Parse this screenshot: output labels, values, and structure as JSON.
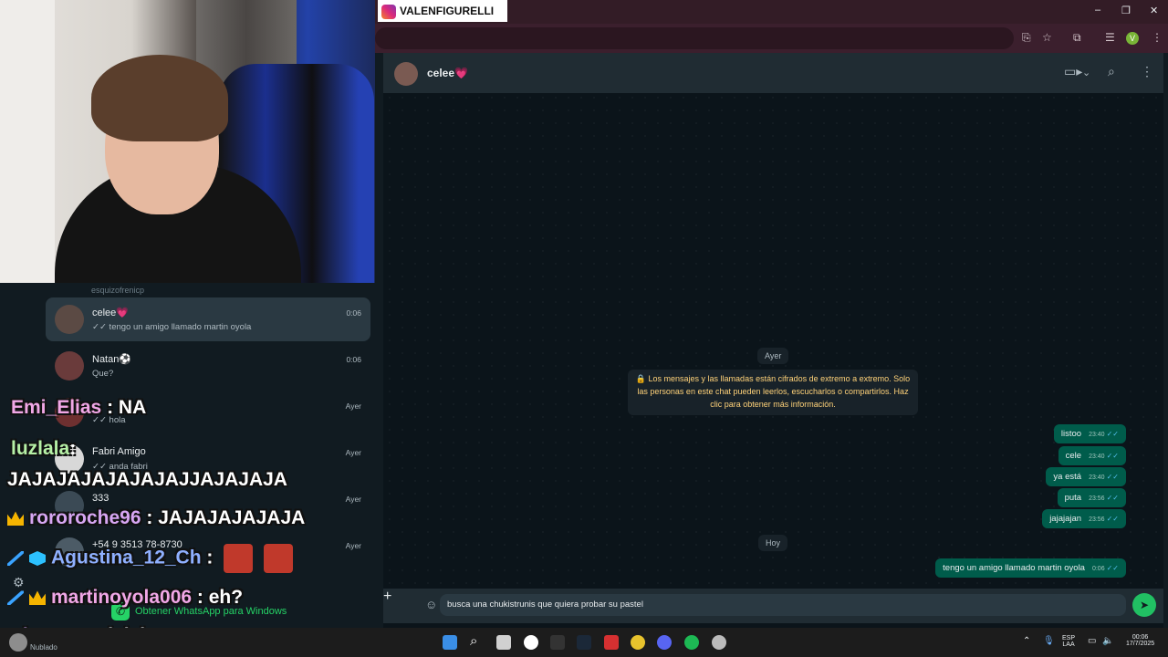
{
  "stream_badge": {
    "name": "VALENFIGURELLI"
  },
  "window_controls": {
    "minimize": "–",
    "restore": "❐",
    "close": "✕"
  },
  "browser": {
    "profile_initial": "V"
  },
  "chat_list": {
    "top_partial": "esquizofrenicp",
    "items": [
      {
        "name": "celee💗",
        "last_message": "✓✓ tengo un amigo llamado martin oyola",
        "time": "0:06"
      },
      {
        "name": "Natan⚽",
        "last_message": "Que?",
        "time": "0:06"
      },
      {
        "name": "",
        "last_message": "✓✓ hola",
        "time": "Ayer"
      },
      {
        "name": "Fabri Amigo",
        "last_message": "✓✓ anda fabri",
        "time": "Ayer"
      },
      {
        "name": "333",
        "last_message": "",
        "time": "Ayer"
      },
      {
        "name": "+54 9 3513 78-8730",
        "last_message": "",
        "time": "Ayer"
      }
    ],
    "promo": "Obtener WhatsApp para Windows"
  },
  "stream_chat": [
    {
      "user": "Emi_Elias",
      "message": "NA"
    },
    {
      "user": "luzlala",
      "message": "JAJAJAJAJAJAJAJJAJAJAJA"
    },
    {
      "user": "rororoche96",
      "message": "JAJAJAJAJAJA"
    },
    {
      "user": "Agustina_12_Ch",
      "message": ""
    },
    {
      "user": "martinoyola006",
      "message": "eh?"
    },
    {
      "user": "nicooaar",
      "message": "jajaja"
    }
  ],
  "weather": {
    "label": "Nublado"
  },
  "conversation": {
    "contact_name": "celee💗",
    "date_yesterday": "Ayer",
    "encryption_notice": "🔒 Los mensajes y las llamadas están cifrados de extremo a extremo. Solo las personas en este chat pueden leerlos, escucharlos o compartirlos. Haz clic para obtener más información.",
    "yesterday_messages": [
      {
        "text": "listoo",
        "time": "23:40"
      },
      {
        "text": "cele",
        "time": "23:40"
      },
      {
        "text": "ya está",
        "time": "23:40"
      },
      {
        "text": "puta",
        "time": "23:56"
      },
      {
        "text": "jajajajan",
        "time": "23:56"
      }
    ],
    "date_today": "Hoy",
    "today_messages": [
      {
        "text": "tengo un amigo llamado martin oyola",
        "time": "0:06"
      }
    ],
    "composer_text": "busca una chukistrunis que quiera probar su pastel"
  },
  "taskbar": {
    "language": "ESP",
    "layout": "LAA",
    "time": "00:06",
    "date": "17/7/2025"
  },
  "colors": {
    "accent": "#21c063",
    "outgoing_bubble": "#005c4b",
    "browser_frame": "#3b1f2d"
  }
}
